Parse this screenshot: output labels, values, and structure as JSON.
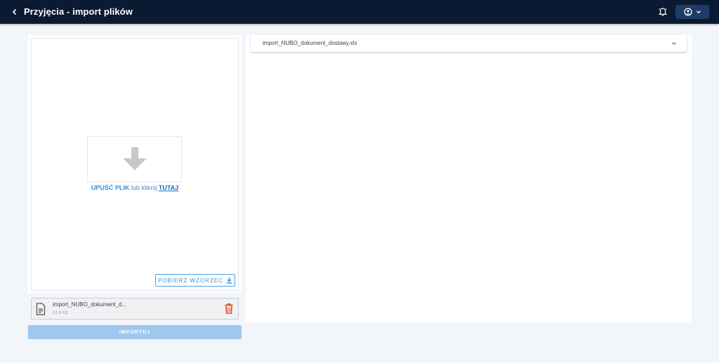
{
  "header": {
    "title": "Przyjęcia - import plików",
    "icons": {
      "back": "chevron-left-icon",
      "notifications": "bell-icon",
      "user": "user-circle-icon",
      "menu": "chevron-down-icon"
    }
  },
  "upload": {
    "drop_strong": "UPUŚĆ PLIK",
    "drop_middle": " lub kliknij ",
    "drop_link": "TUTAJ",
    "template_button": "POBIERZ WZORZEC"
  },
  "file": {
    "name": "import_NUBO_dokument_d...",
    "size": "51.5 KB"
  },
  "actions": {
    "import_button": "IMPORTUJ"
  },
  "preview": {
    "accordion_title": "import_NUBO_dokument_dostawy.xls"
  },
  "colors": {
    "header_bg": "#0b1a33",
    "accent": "#3a8fd6",
    "delete": "#e8461b",
    "import_disabled": "#9ec8ee"
  }
}
